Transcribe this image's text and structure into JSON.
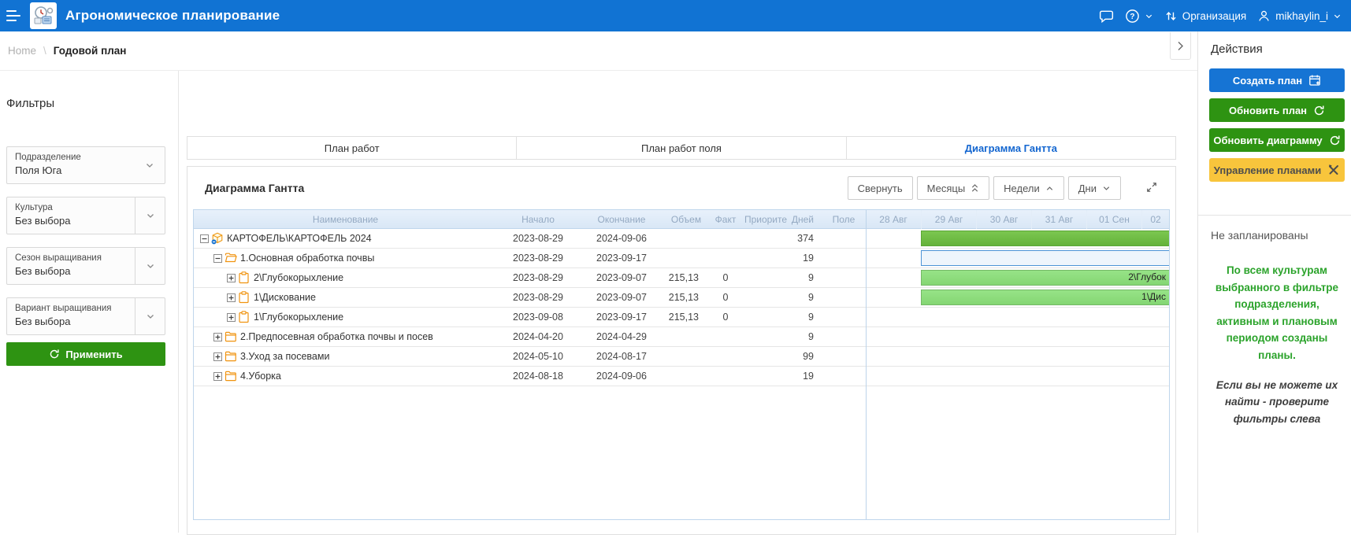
{
  "topbar": {
    "title": "Агрономическое планирование",
    "organization_label": "Организация",
    "user": "mikhaylin_i"
  },
  "breadcrumb": {
    "home": "Home",
    "separator": "\\",
    "current": "Годовой план"
  },
  "filters": {
    "title": "Фильтры",
    "apply_label": "Применить",
    "items": [
      {
        "label": "Подразделение",
        "value": "Поля Юга"
      },
      {
        "label": "Культура",
        "value": "Без выбора"
      },
      {
        "label": "Сезон выращивания",
        "value": "Без выбора"
      },
      {
        "label": "Вариант выращивания",
        "value": "Без выбора"
      }
    ]
  },
  "tabs": [
    {
      "label": "План работ",
      "active": false
    },
    {
      "label": "План работ поля",
      "active": false
    },
    {
      "label": "Диаграмма Гантта",
      "active": true
    }
  ],
  "gantt": {
    "title": "Диаграмма Гантта",
    "toolbar": {
      "collapse": "Свернуть",
      "months": "Месяцы",
      "weeks": "Недели",
      "days": "Дни"
    },
    "columns": [
      "Наименование",
      "Начало",
      "Окончание",
      "Объем",
      "Факт",
      "Приорите",
      "Дней",
      "Поле"
    ],
    "date_columns": [
      "28 Авг",
      "29 Авг",
      "30 Авг",
      "31 Авг",
      "01 Сен",
      "02"
    ],
    "rows": [
      {
        "level": 0,
        "expander": "minus",
        "icon": "crop-icon",
        "name": "КАРТОФЕЛЬ\\КАРТОФЕЛЬ 2024",
        "start": "2023-08-29",
        "end": "2024-09-06",
        "volume": "",
        "fact": "",
        "priority": "",
        "days": "374",
        "field": "",
        "bar": {
          "type": "summary",
          "label": ""
        }
      },
      {
        "level": 1,
        "expander": "minus",
        "icon": "folder-open-icon",
        "name": "1.Основная обработка почвы",
        "start": "2023-08-29",
        "end": "2023-09-17",
        "volume": "",
        "fact": "",
        "priority": "",
        "days": "19",
        "field": "",
        "bar": {
          "type": "outline",
          "label": ""
        }
      },
      {
        "level": 2,
        "expander": "plus",
        "icon": "task-icon",
        "name": "2\\Глубокорыхление",
        "start": "2023-08-29",
        "end": "2023-09-07",
        "volume": "215,13",
        "fact": "0",
        "priority": "",
        "days": "9",
        "field": "",
        "bar": {
          "type": "task",
          "label": "2\\Глубок"
        }
      },
      {
        "level": 2,
        "expander": "plus",
        "icon": "task-icon",
        "name": "1\\Дискование",
        "start": "2023-08-29",
        "end": "2023-09-07",
        "volume": "215,13",
        "fact": "0",
        "priority": "",
        "days": "9",
        "field": "",
        "bar": {
          "type": "task",
          "label": "1\\Дис"
        }
      },
      {
        "level": 2,
        "expander": "plus",
        "icon": "task-icon",
        "name": "1\\Глубокорыхление",
        "start": "2023-09-08",
        "end": "2023-09-17",
        "volume": "215,13",
        "fact": "0",
        "priority": "",
        "days": "9",
        "field": "",
        "bar": null
      },
      {
        "level": 1,
        "expander": "plus",
        "icon": "folder-icon",
        "name": "2.Предпосевная обработка почвы и посев",
        "start": "2024-04-20",
        "end": "2024-04-29",
        "volume": "",
        "fact": "",
        "priority": "",
        "days": "9",
        "field": "",
        "bar": null
      },
      {
        "level": 1,
        "expander": "plus",
        "icon": "folder-icon",
        "name": "3.Уход за посевами",
        "start": "2024-05-10",
        "end": "2024-08-17",
        "volume": "",
        "fact": "",
        "priority": "",
        "days": "99",
        "field": "",
        "bar": null
      },
      {
        "level": 1,
        "expander": "plus",
        "icon": "folder-icon",
        "name": "4.Уборка",
        "start": "2024-08-18",
        "end": "2024-09-06",
        "volume": "",
        "fact": "",
        "priority": "",
        "days": "19",
        "field": "",
        "bar": null
      }
    ]
  },
  "actions": {
    "title": "Действия",
    "buttons": [
      {
        "label": "Создать план",
        "icon": "calendar-plus-icon",
        "style": "blue"
      },
      {
        "label": "Обновить план",
        "icon": "refresh-icon",
        "style": "green"
      },
      {
        "label": "Обновить диаграмму",
        "icon": "refresh-icon",
        "style": "green"
      },
      {
        "label": "Управление планами",
        "icon": "tools-icon",
        "style": "yellow"
      }
    ]
  },
  "unplanned": {
    "title": "Не запланированы",
    "message": "По всем культурам выбранного в фильтре подразделения, активным и плановым периодом созданы планы.",
    "note": "Если вы не можете их найти - проверите фильтры слева"
  },
  "colors": {
    "topbar": "#1173d3",
    "accent_blue": "#1366d0",
    "button_green": "#2e9312",
    "button_yellow": "#f8c53c",
    "bar_summary_green": "#6fc046",
    "bar_task_green": "#8edc7e",
    "bar_outline_blue": "#4d94d6",
    "grid_header_bg": "#dfeaf7",
    "message_green": "#2ba32b"
  }
}
